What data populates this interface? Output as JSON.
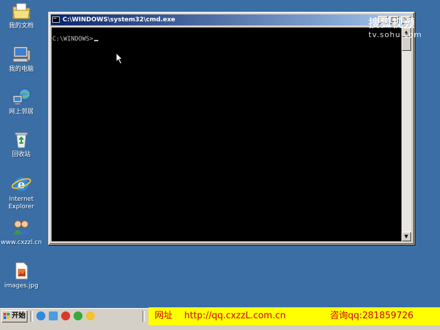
{
  "desktop": {
    "icons": [
      {
        "label": "我的文档",
        "icon": "my-documents-icon"
      },
      {
        "label": "我的电脑",
        "icon": "my-computer-icon"
      },
      {
        "label": "网上邻居",
        "icon": "network-places-icon"
      },
      {
        "label": "回收站",
        "icon": "recycle-bin-icon"
      },
      {
        "label": "Internet",
        "label2": "Explorer",
        "icon": "internet-explorer-icon"
      },
      {
        "label": "www.cxzzl.cn",
        "icon": "users-icon"
      },
      {
        "label": "images.jpg",
        "icon": "image-file-icon"
      }
    ]
  },
  "window": {
    "title": "C:\\WINDOWS\\system32\\cmd.exe",
    "minimize": "_",
    "maximize": "□",
    "close": "×",
    "console_prompt": "C:\\WINDOWS>"
  },
  "watermark": {
    "brand": "搜狐视频",
    "url": "tv.sohu.com"
  },
  "taskbar": {
    "start_label": "开始"
  },
  "banner": {
    "site_label": "网址",
    "site_url": "http://qq.cxzzL.com.cn",
    "contact_label": "咨询qq:281859726"
  },
  "colors": {
    "desktop": "#3a6ea5",
    "titlebar_active": "#0a246a",
    "banner_bg": "#ffff00",
    "banner_text": "#d40000"
  }
}
